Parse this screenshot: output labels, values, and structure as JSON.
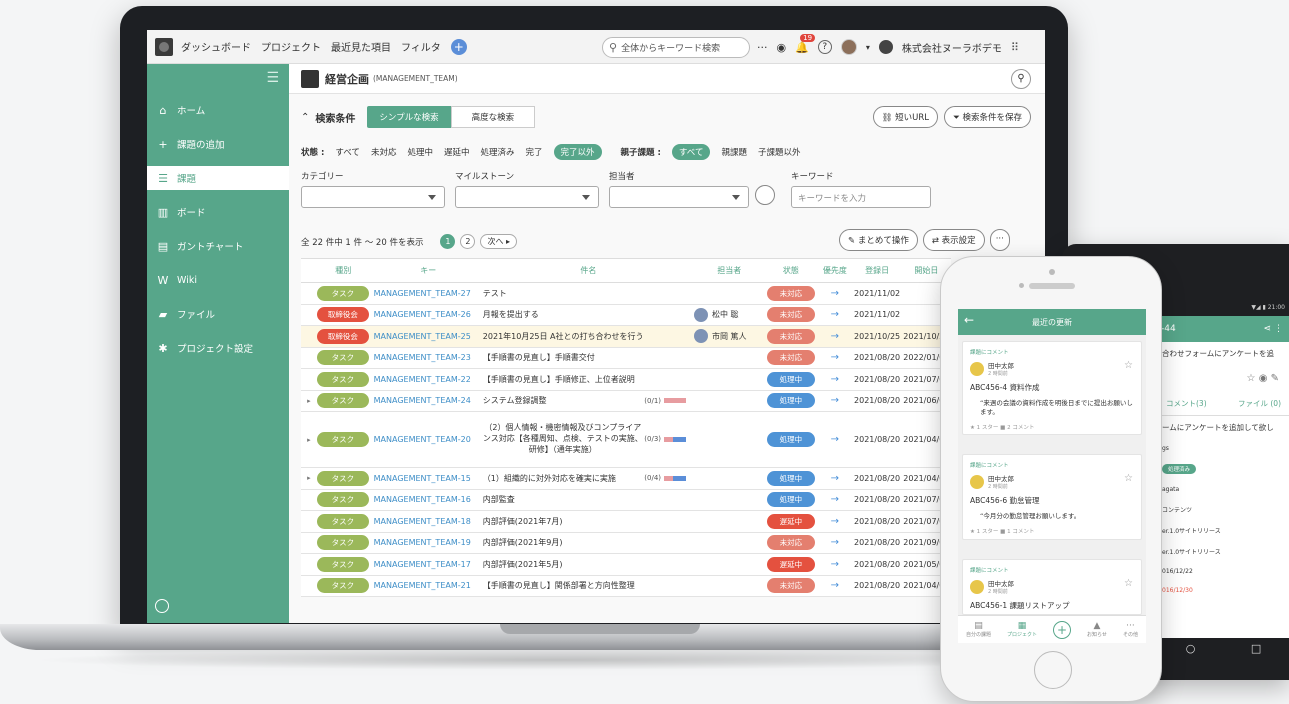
{
  "topbar": {
    "nav": [
      "ダッシュボード",
      "プロジェクト",
      "最近見た項目",
      "フィルタ"
    ],
    "add_symbol": "+",
    "search_placeholder": "全体からキーワード検索",
    "more": "···",
    "notification_count": "19",
    "help": "?",
    "org_name": "株式会社ヌーラボデモ"
  },
  "sidebar": {
    "items": [
      {
        "label": "ホーム",
        "icon": "home-icon",
        "glyph": "⌂"
      },
      {
        "label": "課題の追加",
        "icon": "plus-icon",
        "glyph": "+"
      },
      {
        "label": "課題",
        "icon": "list-icon",
        "glyph": "☰"
      },
      {
        "label": "ボード",
        "icon": "board-icon",
        "glyph": "▥"
      },
      {
        "label": "ガントチャート",
        "icon": "gantt-icon",
        "glyph": "▤"
      },
      {
        "label": "Wiki",
        "icon": "wiki-icon",
        "glyph": "W"
      },
      {
        "label": "ファイル",
        "icon": "folder-icon",
        "glyph": "▰"
      },
      {
        "label": "プロジェクト設定",
        "icon": "gear-icon",
        "glyph": "✱"
      }
    ]
  },
  "project": {
    "name": "経営企画",
    "key": "(MANAGEMENT_TEAM)"
  },
  "conditions": {
    "title": "検索条件",
    "simple": "シンプルな検索",
    "advanced": "高度な検索",
    "short_url": "短いURL",
    "save": "検索条件を保存"
  },
  "status_filter": {
    "label": "状態 :",
    "options": [
      "すべて",
      "未対応",
      "処理中",
      "遅延中",
      "処理済み",
      "完了"
    ],
    "selected": "完了以外",
    "parent_label": "親子課題 :",
    "parent_selected": "すべて",
    "parent_options": [
      "親課題",
      "子課題以外"
    ]
  },
  "filters": {
    "category": "カテゴリー",
    "milestone": "マイルストーン",
    "assignee": "担当者",
    "keyword": "キーワード",
    "keyword_placeholder": "キーワードを入力"
  },
  "paging": {
    "summary": "全 22 件中 1 件 〜 20 件を表示",
    "current": "1",
    "next_page": "2",
    "next": "次へ ▸"
  },
  "actions": {
    "bulk": "まとめて操作",
    "display": "表示設定",
    "more": "···"
  },
  "table": {
    "headers": [
      "種別",
      "キー",
      "件名",
      "担当者",
      "状態",
      "優先度",
      "登録日",
      "開始日"
    ],
    "rows": [
      {
        "exp": "",
        "type": "タスク",
        "tcolor": "#9bb85a",
        "key": "MANAGEMENT_TEAM-27",
        "summary": "テスト",
        "mini": "",
        "user": "",
        "status": "未対応",
        "scolor": "#e47f6f",
        "pri": "→",
        "created": "2021/11/02",
        "start": "",
        "hl": false
      },
      {
        "exp": "",
        "type": "取締役会",
        "tcolor": "#e4513f",
        "key": "MANAGEMENT_TEAM-26",
        "summary": "月報を提出する",
        "mini": "",
        "user": "松中 聡",
        "status": "未対応",
        "scolor": "#e47f6f",
        "pri": "→",
        "created": "2021/11/02",
        "start": "",
        "hl": false
      },
      {
        "exp": "",
        "type": "取締役会",
        "tcolor": "#e4513f",
        "key": "MANAGEMENT_TEAM-25",
        "summary": "2021年10月25日 A社との打ち合わせを行う",
        "mini": "",
        "user": "市岡 篤人",
        "status": "未対応",
        "scolor": "#e47f6f",
        "pri": "→",
        "created": "2021/10/25",
        "start": "2021/10/25",
        "hl": true
      },
      {
        "exp": "",
        "type": "タスク",
        "tcolor": "#9bb85a",
        "key": "MANAGEMENT_TEAM-23",
        "summary": "【手順書の見直し】手順書交付",
        "mini": "",
        "user": "",
        "status": "未対応",
        "scolor": "#e47f6f",
        "pri": "→",
        "created": "2021/08/20",
        "start": "2022/01/01",
        "hl": false
      },
      {
        "exp": "",
        "type": "タスク",
        "tcolor": "#9bb85a",
        "key": "MANAGEMENT_TEAM-22",
        "summary": "【手順書の見直し】手順修正、上位者説明",
        "mini": "",
        "user": "",
        "status": "処理中",
        "scolor": "#4e93d6",
        "pri": "→",
        "created": "2021/08/20",
        "start": "2021/07/01",
        "hl": false
      },
      {
        "exp": "▸",
        "type": "タスク",
        "tcolor": "#9bb85a",
        "key": "MANAGEMENT_TEAM-24",
        "summary": "システム登録調整",
        "mini": "(0/1)",
        "user": "",
        "status": "処理中",
        "scolor": "#4e93d6",
        "pri": "→",
        "created": "2021/08/20",
        "start": "2021/06/01",
        "hl": false
      },
      {
        "exp": "▸",
        "type": "タスク",
        "tcolor": "#9bb85a",
        "key": "MANAGEMENT_TEAM-20",
        "summary": "（2）個人情報・機密情報及びコンプライアンス対応【各種周知、点検、テストの実施、研修】（通年実施）",
        "mini": "(0/3)",
        "user": "",
        "status": "処理中",
        "scolor": "#4e93d6",
        "pri": "→",
        "created": "2021/08/20",
        "start": "2021/04/01",
        "hl": false,
        "tall": true
      },
      {
        "exp": "▸",
        "type": "タスク",
        "tcolor": "#9bb85a",
        "key": "MANAGEMENT_TEAM-15",
        "summary": "（1）組織的に対外対応を確実に実施",
        "mini": "(0/4)",
        "user": "",
        "status": "処理中",
        "scolor": "#4e93d6",
        "pri": "→",
        "created": "2021/08/20",
        "start": "2021/04/01",
        "hl": false
      },
      {
        "exp": "",
        "type": "タスク",
        "tcolor": "#9bb85a",
        "key": "MANAGEMENT_TEAM-16",
        "summary": "内部監査",
        "mini": "",
        "user": "",
        "status": "処理中",
        "scolor": "#4e93d6",
        "pri": "→",
        "created": "2021/08/20",
        "start": "2021/07/01",
        "hl": false
      },
      {
        "exp": "",
        "type": "タスク",
        "tcolor": "#9bb85a",
        "key": "MANAGEMENT_TEAM-18",
        "summary": "内部評価(2021年7月)",
        "mini": "",
        "user": "",
        "status": "遅延中",
        "scolor": "#e4513f",
        "pri": "→",
        "created": "2021/08/20",
        "start": "2021/07/01",
        "hl": false
      },
      {
        "exp": "",
        "type": "タスク",
        "tcolor": "#9bb85a",
        "key": "MANAGEMENT_TEAM-19",
        "summary": "内部評価(2021年9月)",
        "mini": "",
        "user": "",
        "status": "未対応",
        "scolor": "#e47f6f",
        "pri": "→",
        "created": "2021/08/20",
        "start": "2021/09/01",
        "hl": false
      },
      {
        "exp": "",
        "type": "タスク",
        "tcolor": "#9bb85a",
        "key": "MANAGEMENT_TEAM-17",
        "summary": "内部評価(2021年5月)",
        "mini": "",
        "user": "",
        "status": "遅延中",
        "scolor": "#e4513f",
        "pri": "→",
        "created": "2021/08/20",
        "start": "2021/05/01",
        "hl": false
      },
      {
        "exp": "",
        "type": "タスク",
        "tcolor": "#9bb85a",
        "key": "MANAGEMENT_TEAM-21",
        "summary": "【手順書の見直し】関係部署と方向性整理",
        "mini": "",
        "user": "",
        "status": "未対応",
        "scolor": "#e47f6f",
        "pri": "→",
        "created": "2021/08/20",
        "start": "2021/04/01",
        "hl": false
      }
    ]
  },
  "phone": {
    "title": "最近の更新",
    "cards": [
      {
        "tag": "課題にコメント",
        "user": "田中太郎",
        "time": "2 時間前",
        "title": "ABC456-4 資料作成",
        "body": "“来週の会議の資料作成を明後日までに提出お願いします。",
        "meta": "★ 1 スター    ■ 2 コメント"
      },
      {
        "tag": "課題にコメント",
        "user": "田中太郎",
        "time": "2 時間前",
        "title": "ABC456-6 勤怠管理",
        "body": "“今月分の勤怠管理お願いします。",
        "meta": "★ 1 スター    ■ 1 コメント"
      },
      {
        "tag": "課題にコメント",
        "user": "田中太郎",
        "time": "2 時間前",
        "title": "ABC456-1 課題リストアップ",
        "body": "",
        "meta": ""
      }
    ],
    "tabs": [
      "自分の課題",
      "プロジェクト",
      "",
      "お知らせ",
      "その他"
    ]
  },
  "tablet": {
    "status": "▼◢ ▮ 21:00",
    "issue": "-44",
    "line1": "合わせフォームにアンケートを追",
    "tab_comment": "コメント(3)",
    "tab_file": "ファイル (0)",
    "line2": "ームにアンケートを追加して欲し",
    "lines": [
      "gs",
      "処理済み",
      "agata",
      "コンテンツ",
      "er.1.0サイトリリース",
      "er.1.0サイトリリース",
      "016/12/22",
      "016/12/30"
    ]
  }
}
